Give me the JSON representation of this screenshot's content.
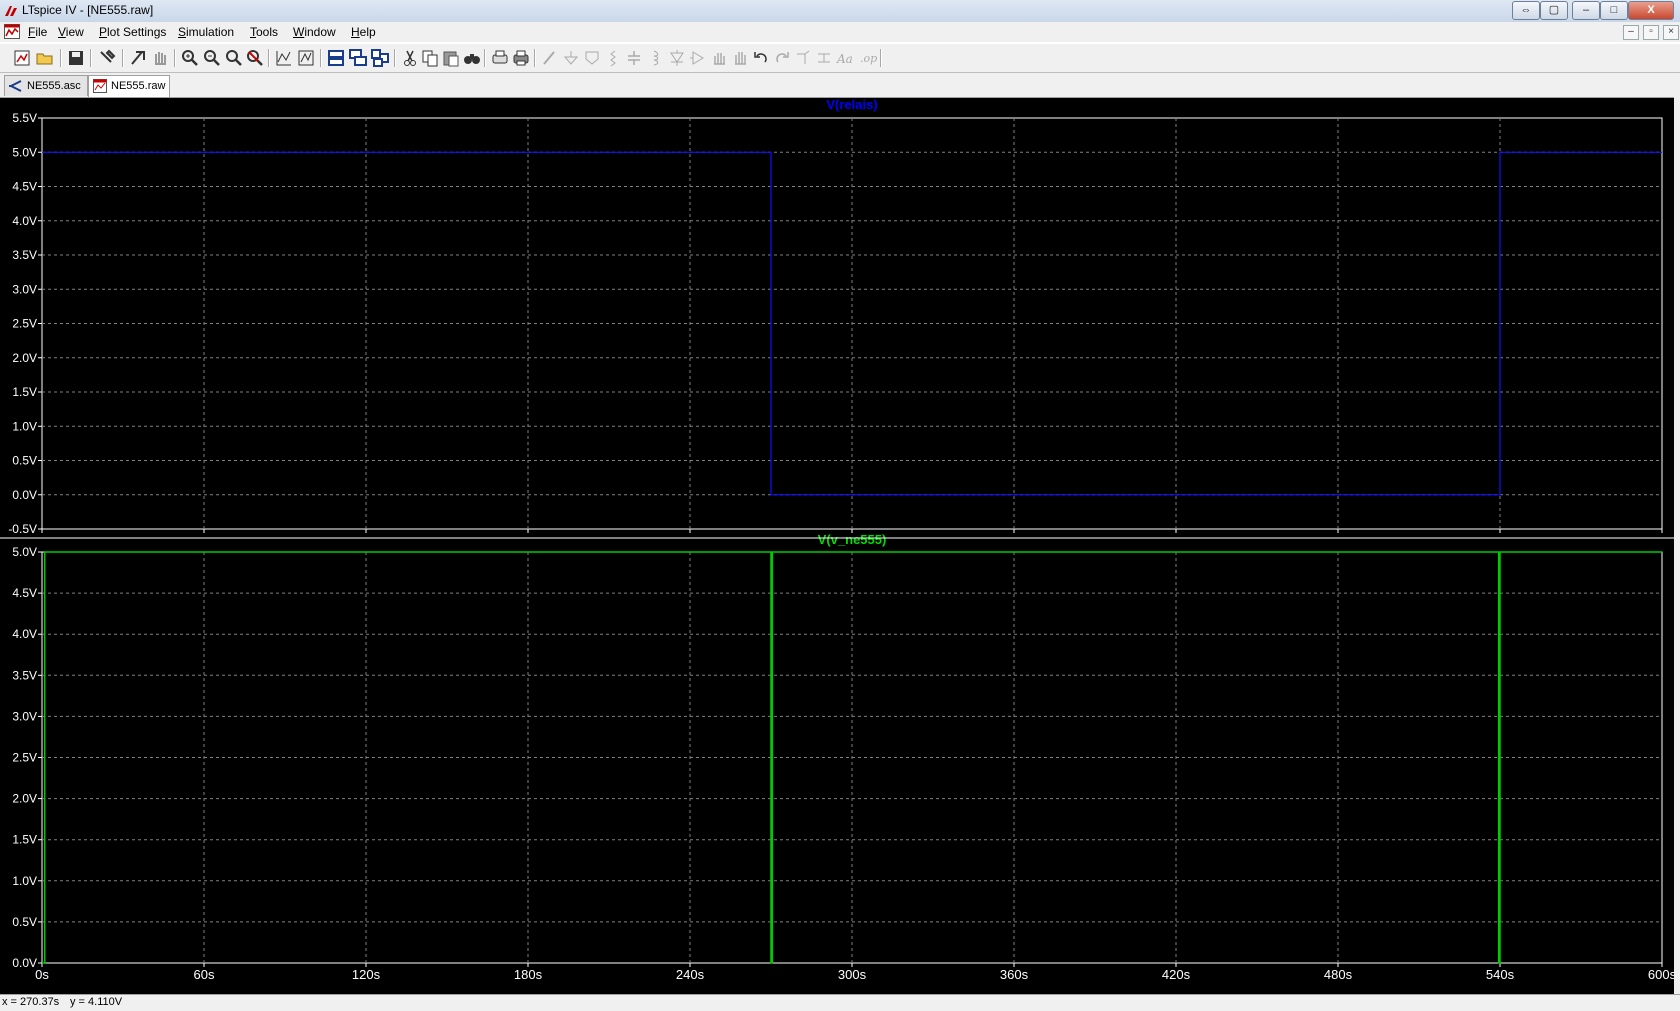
{
  "window": {
    "title": "LTspice IV - [NE555.raw]"
  },
  "caption_buttons": {
    "restore_alt": "⇔",
    "resize": "▢",
    "minimize": "–",
    "maximize": "□",
    "close": "X"
  },
  "mdi_buttons": {
    "minimize": "–",
    "restore": "▫",
    "close": "×"
  },
  "menu": [
    {
      "label": "File",
      "underline": "F",
      "rest": "ile"
    },
    {
      "label": "View",
      "underline": "V",
      "rest": "iew"
    },
    {
      "label": "Plot Settings",
      "underline": "P",
      "rest": "lot Settings"
    },
    {
      "label": "Simulation",
      "underline": "S",
      "rest": "imulation"
    },
    {
      "label": "Tools",
      "underline": "T",
      "rest": "ools"
    },
    {
      "label": "Window",
      "underline": "W",
      "rest": "indow"
    },
    {
      "label": "Help",
      "underline": "H",
      "rest": "elp"
    }
  ],
  "toolbar": {
    "icons": [
      "new-schematic-icon",
      "open-icon",
      "save-icon",
      "control-panel-icon",
      "run-icon",
      "halt-icon",
      "zoom-in-icon",
      "zoom-out-icon",
      "zoom-fit-icon",
      "zoom-cancel-icon",
      "autorange-icon",
      "mark-unref-icon",
      "tile-horizontal-icon",
      "cascade-icon",
      "tile-vertical-icon",
      "cut-icon",
      "copy-icon",
      "paste-icon",
      "find-icon",
      "print-preview-icon",
      "print-icon",
      "wire-icon",
      "ground-icon",
      "label-net-icon",
      "resistor-icon",
      "capacitor-icon",
      "inductor-icon",
      "diode-icon",
      "component-icon",
      "move-icon",
      "drag-icon",
      "undo-icon",
      "redo-icon",
      "rotate-icon",
      "mirror-icon",
      "text-icon",
      "spice-directive-icon"
    ]
  },
  "tabs": [
    {
      "label": "NE555.asc",
      "icon": "schematic-icon",
      "active": false
    },
    {
      "label": "NE555.raw",
      "icon": "waveform-icon",
      "active": true
    }
  ],
  "status": {
    "x": "x = 270.37s",
    "y": "y = 4.110V"
  },
  "colors": {
    "trace1": "#1010ff",
    "trace2": "#00cc00",
    "grid": "#808080",
    "axis_text": "#ffffff",
    "bg": "#000000"
  },
  "chart_data": [
    {
      "type": "line",
      "title": "V(relais)",
      "xlim": [
        0,
        600
      ],
      "ylim": [
        -0.5,
        5.5
      ],
      "y_ticks": [
        "5.5V",
        "5.0V",
        "4.5V",
        "4.0V",
        "3.5V",
        "3.0V",
        "2.5V",
        "2.0V",
        "1.5V",
        "1.0V",
        "0.5V",
        "0.0V",
        "-0.5V"
      ],
      "y_tick_values": [
        5.5,
        5.0,
        4.5,
        4.0,
        3.5,
        3.0,
        2.5,
        2.0,
        1.5,
        1.0,
        0.5,
        0.0,
        -0.5
      ],
      "x_ticks": [
        0,
        60,
        120,
        180,
        240,
        300,
        360,
        420,
        480,
        540,
        600
      ],
      "grid": true,
      "series": [
        {
          "name": "V(relais)",
          "x": [
            0,
            270,
            270,
            540,
            540,
            600
          ],
          "y": [
            5.0,
            5.0,
            0.0,
            0.0,
            5.0,
            5.0
          ]
        }
      ]
    },
    {
      "type": "line",
      "title": "V(v_ne555)",
      "xlim": [
        0,
        600
      ],
      "ylim": [
        0,
        5.0
      ],
      "y_ticks": [
        "5.0V",
        "4.5V",
        "4.0V",
        "3.5V",
        "3.0V",
        "2.5V",
        "2.0V",
        "1.5V",
        "1.0V",
        "0.5V",
        "0.0V"
      ],
      "y_tick_values": [
        5.0,
        4.5,
        4.0,
        3.5,
        3.0,
        2.5,
        2.0,
        1.5,
        1.0,
        0.5,
        0.0
      ],
      "x_ticks": [
        0,
        60,
        120,
        180,
        240,
        300,
        360,
        420,
        480,
        540,
        600
      ],
      "x_tick_labels": [
        "0s",
        "60s",
        "120s",
        "180s",
        "240s",
        "300s",
        "360s",
        "420s",
        "480s",
        "540s",
        "600s"
      ],
      "grid": true,
      "series": [
        {
          "name": "V(v_ne555)",
          "x": [
            0,
            1,
            1,
            270,
            270,
            270.5,
            270.5,
            539.5,
            539.5,
            540,
            540,
            600
          ],
          "y": [
            0,
            0,
            5,
            5,
            0,
            0,
            5,
            5,
            0,
            0,
            5,
            5
          ]
        }
      ]
    }
  ]
}
